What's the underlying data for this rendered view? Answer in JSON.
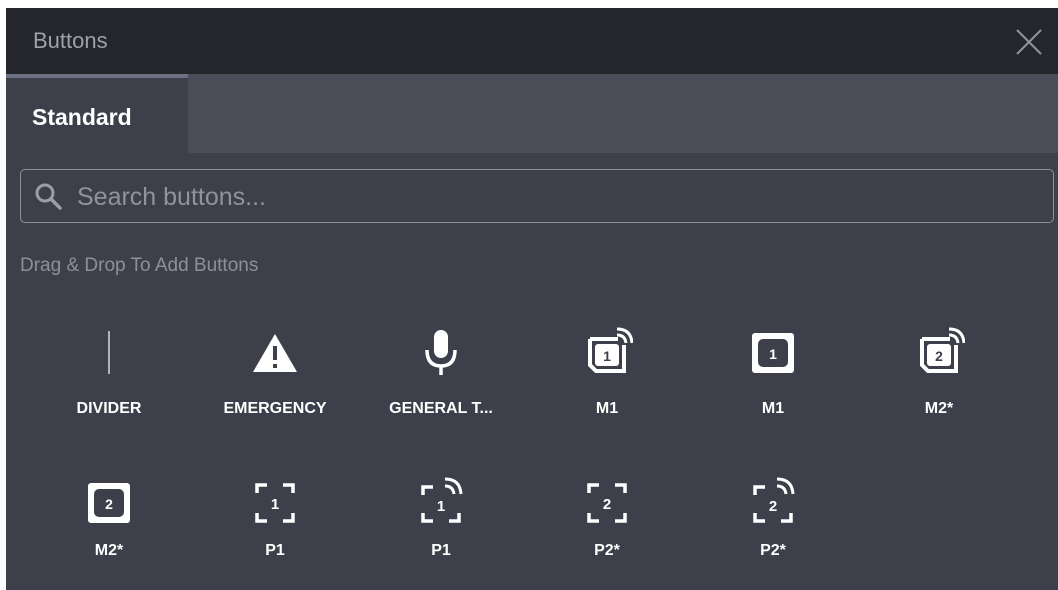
{
  "window": {
    "title": "Buttons"
  },
  "tabs": [
    {
      "label": "Standard"
    }
  ],
  "search": {
    "placeholder": "Search buttons...",
    "value": ""
  },
  "hint": "Drag & Drop To Add Buttons",
  "buttons": [
    {
      "label": "DIVIDER",
      "icon": "divider-icon"
    },
    {
      "label": "EMERGENCY",
      "icon": "warning-icon"
    },
    {
      "label": "GENERAL T...",
      "icon": "microphone-icon"
    },
    {
      "label": "M1",
      "icon": "memory-1-signal-icon"
    },
    {
      "label": "M1",
      "icon": "memory-1-icon"
    },
    {
      "label": "M2*",
      "icon": "memory-2-signal-icon"
    },
    {
      "label": "M2*",
      "icon": "memory-2-icon"
    },
    {
      "label": "P1",
      "icon": "preset-1-icon"
    },
    {
      "label": "P1",
      "icon": "preset-1-signal-icon"
    },
    {
      "label": "P2*",
      "icon": "preset-2-icon"
    },
    {
      "label": "P2*",
      "icon": "preset-2-signal-icon"
    }
  ],
  "digits": {
    "one": "1",
    "two": "2"
  },
  "colors": {
    "panel": "#3d404a",
    "titlebar": "#25262b",
    "tabbar": "#4a4d57",
    "text": "#ffffff"
  }
}
